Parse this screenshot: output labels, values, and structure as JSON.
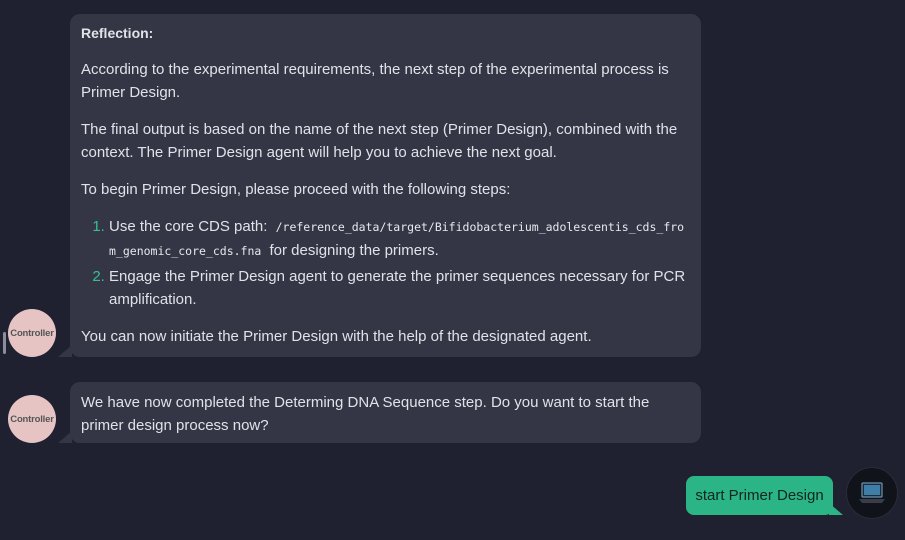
{
  "messages": [
    {
      "sender": "Controller",
      "heading": "Reflection:",
      "p1": "According to the experimental requirements, the next step of the experimental process is Primer Design.",
      "p2": "The final output is based on the name of the next step (Primer Design), combined with the context. The Primer Design agent will help you to achieve the next goal.",
      "p3": "To begin Primer Design, please proceed with the following steps:",
      "steps": [
        {
          "before": "Use the core CDS path:",
          "code": "/reference_data/target/Bifidobacterium_adolescentis_cds_from_genomic_core_cds.fna",
          "after": "for designing the primers."
        },
        {
          "text": "Engage the Primer Design agent to generate the primer sequences necessary for PCR amplification."
        }
      ],
      "p4": "You can now initiate the Primer Design with the help of the designated agent."
    },
    {
      "sender": "Controller",
      "text": "We have now completed the Determing DNA Sequence step. Do you want to start the primer design process now?"
    }
  ],
  "user_message": {
    "text": "start Primer Design",
    "avatar_icon": "laptop-icon"
  },
  "colors": {
    "background": "#1f2030",
    "bubble": "#343646",
    "user_bubble": "#2bb486",
    "list_marker": "#36c08f",
    "avatar": "#e6c4c4"
  }
}
